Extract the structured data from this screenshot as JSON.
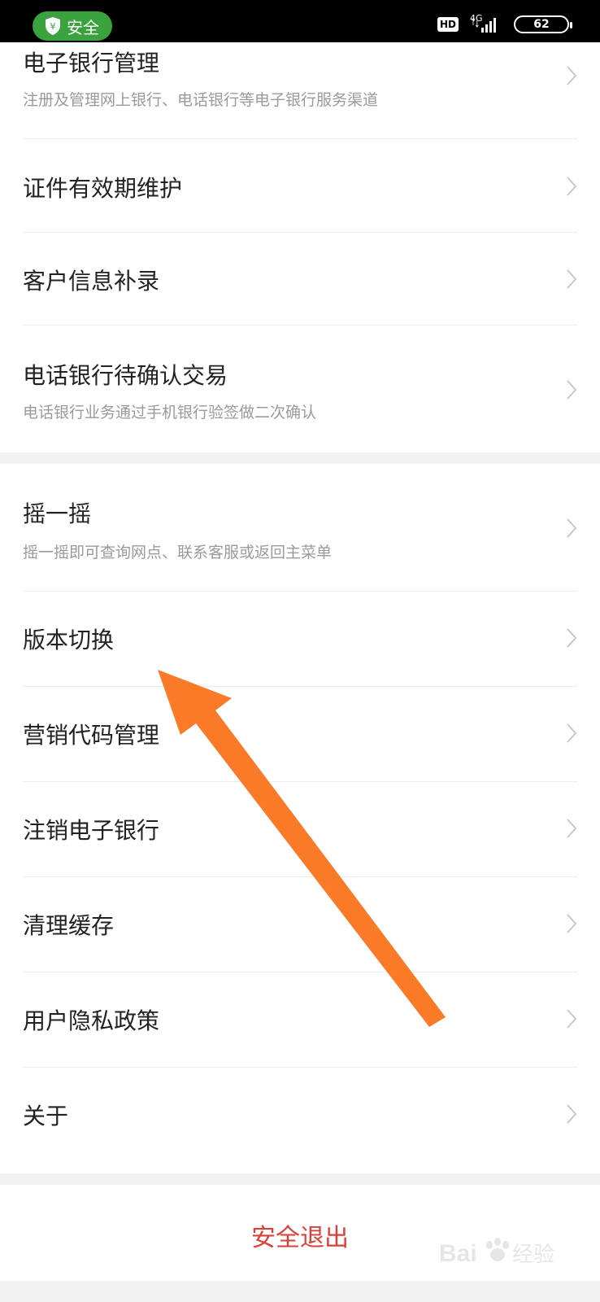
{
  "status_bar": {
    "safe_label": "安全",
    "hd_label": "HD",
    "network_label": "4G",
    "battery_level": "62"
  },
  "menu_group_1": [
    {
      "title": "电子银行管理",
      "subtitle": "注册及管理网上银行、电话银行等电子银行服务渠道"
    },
    {
      "title": "证件有效期维护",
      "subtitle": ""
    },
    {
      "title": "客户信息补录",
      "subtitle": ""
    },
    {
      "title": "电话银行待确认交易",
      "subtitle": "电话银行业务通过手机银行验签做二次确认"
    }
  ],
  "menu_group_2": [
    {
      "title": "摇一摇",
      "subtitle": "摇一摇即可查询网点、联系客服或返回主菜单"
    },
    {
      "title": "版本切换",
      "subtitle": ""
    },
    {
      "title": "营销代码管理",
      "subtitle": ""
    },
    {
      "title": "注销电子银行",
      "subtitle": ""
    },
    {
      "title": "清理缓存",
      "subtitle": ""
    },
    {
      "title": "用户隐私政策",
      "subtitle": ""
    },
    {
      "title": "关于",
      "subtitle": ""
    }
  ],
  "logout_label": "安全退出",
  "watermark_text": "Bai经验",
  "colors": {
    "safe_green": "#3aa33e",
    "logout_red": "#d9403a",
    "arrow_orange": "#fb7a28"
  },
  "icons": {
    "shield": "shield-icon",
    "chevron": "chevron-right-icon"
  }
}
